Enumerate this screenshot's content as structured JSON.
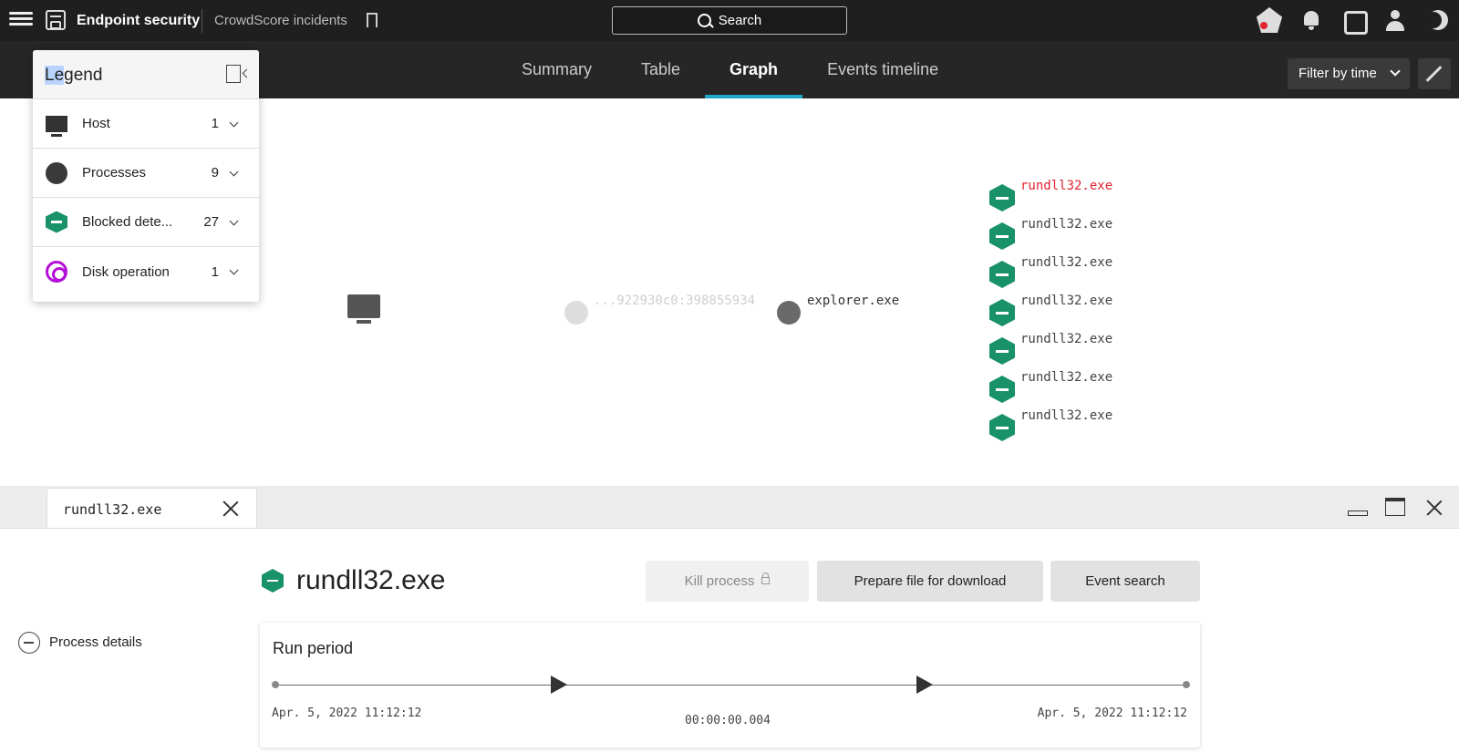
{
  "header": {
    "app_title": "Endpoint security",
    "breadcrumb": "CrowdScore incidents",
    "search_label": "Search"
  },
  "tabs": [
    {
      "label": "Summary"
    },
    {
      "label": "Table"
    },
    {
      "label": "Graph"
    },
    {
      "label": "Events timeline"
    }
  ],
  "filter_label": "Filter by time",
  "legend": {
    "title_highlight": "Le",
    "title_rest": "gend",
    "rows": [
      {
        "label": "Host",
        "count": "1",
        "icon": "monitor-icon"
      },
      {
        "label": "Processes",
        "count": "9",
        "icon": "process-circle-icon"
      },
      {
        "label": "Blocked dete...",
        "count": "27",
        "icon": "blocked-hexagon-icon"
      },
      {
        "label": "Disk operation",
        "count": "1",
        "icon": "disk-target-icon"
      }
    ]
  },
  "graph": {
    "faded_node_label": "...922930c0:398855934",
    "process_node_label": "explorer.exe",
    "detections": [
      {
        "label": "rundll32.exe",
        "selected": true
      },
      {
        "label": "rundll32.exe"
      },
      {
        "label": "rundll32.exe"
      },
      {
        "label": "rundll32.exe"
      },
      {
        "label": "rundll32.exe"
      },
      {
        "label": "rundll32.exe"
      },
      {
        "label": "rundll32.exe"
      }
    ]
  },
  "panel": {
    "tab_label": "rundll32.exe",
    "process_details_label": "Process details",
    "title": "rundll32.exe",
    "kill_label": "Kill process",
    "prepare_label": "Prepare file for download",
    "event_search_label": "Event search",
    "run_period": {
      "title": "Run period",
      "start": "Apr. 5, 2022 11:12:12",
      "end": "Apr. 5, 2022 11:12:12",
      "duration": "00:00:00.004"
    }
  },
  "colors": {
    "accent_tab": "#1fa7c9",
    "detection_green": "#19926a",
    "selected_red": "#e2232e",
    "disk_purple": "#b30fd6"
  }
}
